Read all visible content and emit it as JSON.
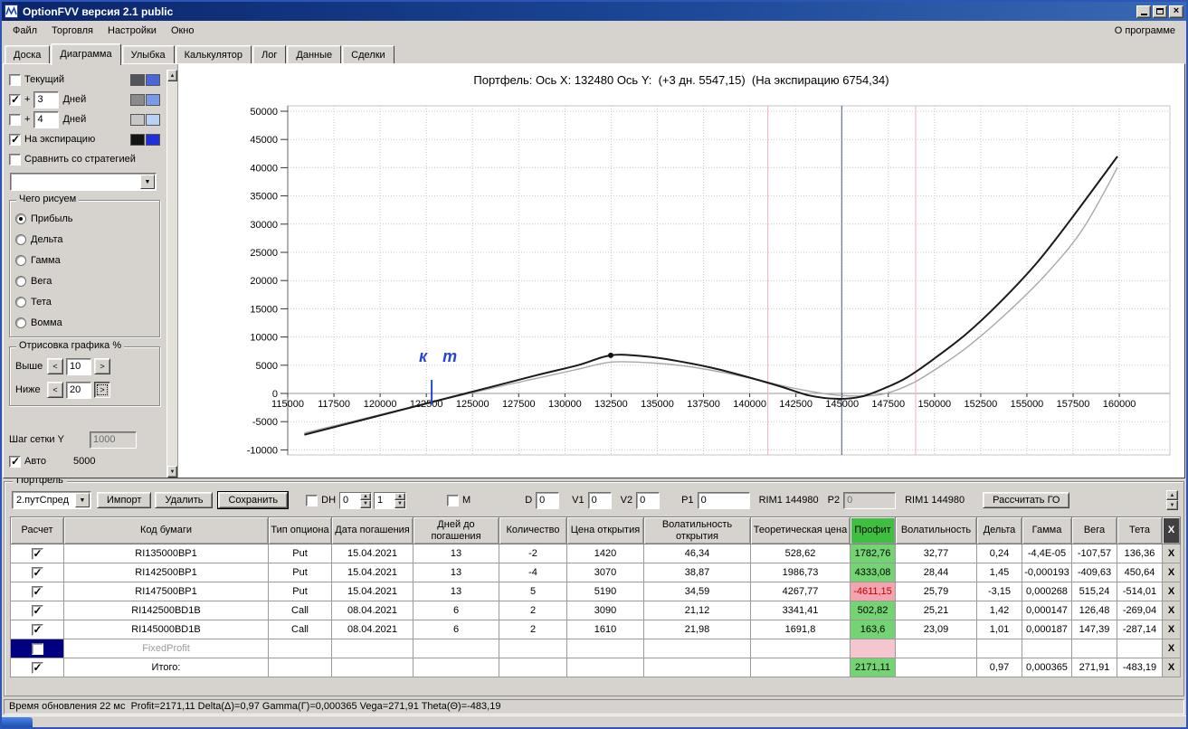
{
  "window": {
    "title": "OptionFVV версия 2.1 public",
    "menu": [
      "Файл",
      "Торговля",
      "Настройки",
      "Окно"
    ],
    "about": "О программе",
    "tabs": [
      "Доска",
      "Диаграмма",
      "Улыбка",
      "Калькулятор",
      "Лог",
      "Данные",
      "Сделки"
    ],
    "active_tab": 1
  },
  "left_panel": {
    "curve_rows": [
      {
        "checked": false,
        "prefix": "",
        "input": "",
        "label": "Текущий",
        "swatch1": "#54545c",
        "swatch2": "#4a66d8"
      },
      {
        "checked": true,
        "prefix": "+",
        "input": "3",
        "label": "Дней",
        "swatch1": "#8a8a8a",
        "swatch2": "#7a9ae8"
      },
      {
        "checked": false,
        "prefix": "+",
        "input": "4",
        "label": "Дней",
        "swatch1": "#c6c6c6",
        "swatch2": "#b8d2f6"
      },
      {
        "checked": true,
        "prefix": "",
        "input": "",
        "label": "На экспирацию",
        "swatch1": "#141414",
        "swatch2": "#2030d8"
      }
    ],
    "compare": {
      "checked": false,
      "label": "Сравнить со стратегией"
    },
    "strategy_value": "",
    "draw_group": {
      "title": "Чего рисуем",
      "options": [
        "Прибыль",
        "Дельта",
        "Гамма",
        "Вега",
        "Тета",
        "Вомма"
      ],
      "selected": 0
    },
    "render_group": {
      "title": "Отрисовка графика %",
      "rows": [
        {
          "label": "Выше",
          "value": "10",
          "focused": false
        },
        {
          "label": "Ниже",
          "value": "20",
          "focused": true
        }
      ]
    },
    "grid_step_label": "Шаг сетки Y",
    "grid_step_value": "1000",
    "auto_label": "Авто",
    "auto_checked": true,
    "auto_value": "5000"
  },
  "chart_data": {
    "type": "line",
    "title": "Портфель: Ось X: 132480 Ось Y:  (+3 дн. 5547,15)  (На экспирацию 6754,34)",
    "xlabel": "",
    "ylabel": "",
    "xlim": [
      115000,
      161700
    ],
    "ylim": [
      -11000,
      51000
    ],
    "grid": true,
    "x_ticks": [
      115000,
      117500,
      120000,
      122500,
      125000,
      127500,
      130000,
      132500,
      135000,
      137500,
      140000,
      142500,
      145000,
      147500,
      150000,
      152500,
      155000,
      157500,
      160000
    ],
    "y_ticks": [
      50000,
      45000,
      40000,
      35000,
      30000,
      25000,
      20000,
      15000,
      10000,
      5000,
      0,
      -5000,
      -10000
    ],
    "marker_lines": [
      {
        "x": 140980,
        "color": "#f0b0c2",
        "w": 1
      },
      {
        "x": 144980,
        "color": "#64748e",
        "w": 1.2
      },
      {
        "x": 148980,
        "color": "#f0b0c2",
        "w": 1
      }
    ],
    "series": [
      {
        "name": "plus-3-days",
        "color": "#a8a8a8",
        "width": 1.4,
        "points": [
          [
            115900,
            -7000
          ],
          [
            118500,
            -4950
          ],
          [
            121000,
            -2950
          ],
          [
            123500,
            -1000
          ],
          [
            126000,
            900
          ],
          [
            128500,
            2700
          ],
          [
            130700,
            4300
          ],
          [
            132480,
            5547
          ],
          [
            134500,
            5450
          ],
          [
            136500,
            4850
          ],
          [
            138500,
            3750
          ],
          [
            140500,
            2350
          ],
          [
            142500,
            850
          ],
          [
            144300,
            -150
          ],
          [
            145800,
            -450
          ],
          [
            147300,
            -50
          ],
          [
            148800,
            1800
          ],
          [
            150300,
            4800
          ],
          [
            152000,
            8800
          ],
          [
            154000,
            14500
          ],
          [
            156000,
            21000
          ],
          [
            158000,
            29000
          ],
          [
            159900,
            40000
          ]
        ]
      },
      {
        "name": "expiration",
        "color": "#1a1a1a",
        "width": 2,
        "points": [
          [
            115900,
            -7300
          ],
          [
            118500,
            -5150
          ],
          [
            121000,
            -3050
          ],
          [
            123500,
            -950
          ],
          [
            126000,
            1150
          ],
          [
            128500,
            3250
          ],
          [
            130700,
            5000
          ],
          [
            132480,
            6754
          ],
          [
            134200,
            6600
          ],
          [
            136000,
            5800
          ],
          [
            138000,
            4500
          ],
          [
            140000,
            2800
          ],
          [
            141700,
            1200
          ],
          [
            143200,
            -350
          ],
          [
            144700,
            -950
          ],
          [
            146000,
            -600
          ],
          [
            147200,
            800
          ],
          [
            148500,
            2800
          ],
          [
            150000,
            6200
          ],
          [
            151700,
            10500
          ],
          [
            153500,
            16000
          ],
          [
            155500,
            23000
          ],
          [
            157300,
            30500
          ],
          [
            159900,
            42000
          ]
        ]
      }
    ],
    "peak_dot": {
      "x": 132480,
      "y": 6754
    },
    "annotation": {
      "text": "к т",
      "x": 122100,
      "y": 5600,
      "color": "#2846d4"
    },
    "hand_tick": {
      "x": 122790,
      "y_from": -1900,
      "y_to": 2400,
      "color": "#2846d4"
    }
  },
  "portfolio": {
    "group_label": "Портфель",
    "toolbar": {
      "strategy": "2.путСпред",
      "import": "Импорт",
      "delete": "Удалить",
      "save": "Сохранить",
      "dh_label": "DH",
      "dh_checked": false,
      "spin1": "0",
      "spin2": "1",
      "m_label": "M",
      "m_checked": false,
      "d_label": "D",
      "d_value": "0",
      "v1_label": "V1",
      "v1_value": "0",
      "v2_label": "V2",
      "v2_value": "0",
      "p1_label": "P1",
      "p1_value": "0",
      "rim1_label": "RIM1 144980",
      "p2_label": "P2",
      "p2_value": "0",
      "rim2_label": "RIM1 144980",
      "calc_go": "Рассчитать ГО"
    },
    "table": {
      "headers": [
        "Расчет",
        "Код бумаги",
        "Тип опциона",
        "Дата погашения",
        "Дней до погашения",
        "Количество",
        "Цена открытия",
        "Волатильность открытия",
        "Теоретическая цена",
        "Профит",
        "Волатильность",
        "Дельта",
        "Гамма",
        "Вега",
        "Тета",
        "Х"
      ],
      "rows": [
        {
          "checked": true,
          "selected": false,
          "muted": false,
          "profit_state": "pos",
          "cells": [
            "RI135000BP1",
            "Put",
            "15.04.2021",
            "13",
            "-2",
            "1420",
            "46,34",
            "528,62",
            "1782,76",
            "32,77",
            "0,24",
            "-4,4E-05",
            "-107,57",
            "136,36"
          ]
        },
        {
          "checked": true,
          "selected": false,
          "muted": false,
          "profit_state": "pos",
          "cells": [
            "RI142500BP1",
            "Put",
            "15.04.2021",
            "13",
            "-4",
            "3070",
            "38,87",
            "1986,73",
            "4333,08",
            "28,44",
            "1,45",
            "-0,000193",
            "-409,63",
            "450,64"
          ]
        },
        {
          "checked": true,
          "selected": false,
          "muted": false,
          "profit_state": "neg",
          "cells": [
            "RI147500BP1",
            "Put",
            "15.04.2021",
            "13",
            "5",
            "5190",
            "34,59",
            "4267,77",
            "-4611,15",
            "25,79",
            "-3,15",
            "0,000268",
            "515,24",
            "-514,01"
          ]
        },
        {
          "checked": true,
          "selected": false,
          "muted": false,
          "profit_state": "pos",
          "cells": [
            "RI142500BD1B",
            "Call",
            "08.04.2021",
            "6",
            "2",
            "3090",
            "21,12",
            "3341,41",
            "502,82",
            "25,21",
            "1,42",
            "0,000147",
            "126,48",
            "-269,04"
          ]
        },
        {
          "checked": true,
          "selected": false,
          "muted": false,
          "profit_state": "pos",
          "cells": [
            "RI145000BD1B",
            "Call",
            "08.04.2021",
            "6",
            "2",
            "1610",
            "21,98",
            "1691,8",
            "163,6",
            "23,09",
            "1,01",
            "0,000187",
            "147,39",
            "-287,14"
          ]
        },
        {
          "checked": false,
          "selected": true,
          "muted": true,
          "profit_state": "dim",
          "cells": [
            "FixedProfit",
            "",
            "",
            "",
            "",
            "",
            "",
            "",
            "",
            "",
            "",
            "",
            "",
            ""
          ]
        },
        {
          "checked": true,
          "selected": false,
          "muted": false,
          "profit_state": "pos",
          "cells": [
            "Итого:",
            "",
            "",
            "",
            "",
            "",
            "",
            "",
            "2171,11",
            "",
            "0,97",
            "0,000365",
            "271,91",
            "-483,19"
          ]
        }
      ]
    }
  },
  "status": {
    "text": "Время обновления 22 мс  Profit=2171,11 Delta(Δ)=0,97 Gamma(Г)=0,000365 Vega=271,91 Theta(Θ)=-483,19"
  }
}
